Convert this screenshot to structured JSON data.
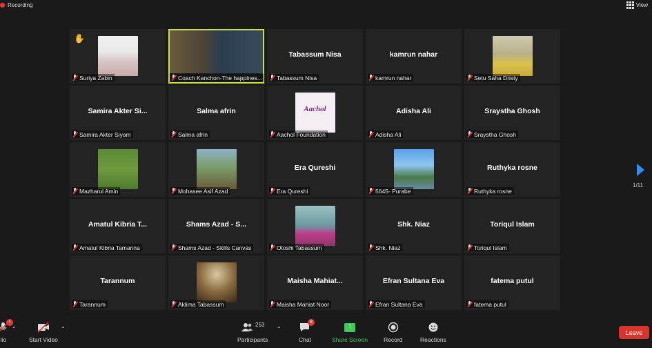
{
  "topbar": {
    "recording_label": "Recording",
    "view_label": "View"
  },
  "tiles": [
    {
      "display": "",
      "label": "Suriya Zabin",
      "photo": "ph-hijab",
      "hand": true
    },
    {
      "display": "",
      "label": "Coach Kanchon-The happines...",
      "photo": "ph-coach",
      "active": true
    },
    {
      "display": "Tabassum Nisa",
      "label": "Tabassum Nisa"
    },
    {
      "display": "kamrun nahar",
      "label": "kamrun nahar"
    },
    {
      "display": "",
      "label": "Setu Saha Dristy",
      "photo": "ph-setu"
    },
    {
      "display": "Samira Akter Si...",
      "label": "Samira Akter Siyam"
    },
    {
      "display": "Salma afrin",
      "label": "Salma afrin"
    },
    {
      "display": "",
      "label": "Aachol Foundation",
      "photo": "ph-aachol",
      "logo_text": "Aachol"
    },
    {
      "display": "Adisha Ali",
      "label": "Adisha Ali"
    },
    {
      "display": "Sraystha Ghosh",
      "label": "Sraystha Ghosh"
    },
    {
      "display": "",
      "label": "Mazharul Amin",
      "photo": "ph-mazhar"
    },
    {
      "display": "",
      "label": "Mohasee Asif Azad",
      "photo": "ph-mohasee"
    },
    {
      "display": "Era Qureshi",
      "label": "Era Qureshi"
    },
    {
      "display": "",
      "label": "5645- Purabe",
      "photo": "ph-5645"
    },
    {
      "display": "Ruthyka rosne",
      "label": "Ruthyka rosne"
    },
    {
      "display": "Amatul Kibria T...",
      "label": "Amatul Kibria Tamanna"
    },
    {
      "display": "Shams Azad - S...",
      "label": "Shams Azad - Skills Canvas"
    },
    {
      "display": "",
      "label": "Otoshi Tabassum",
      "photo": "ph-otoshi"
    },
    {
      "display": "Shk. Niaz",
      "label": "Shk. Niaz"
    },
    {
      "display": "Toriqul Islam",
      "label": "Toriqul Islam"
    },
    {
      "display": "Tarannum",
      "label": "Tarannum"
    },
    {
      "display": "",
      "label": "Aklima Tabassum",
      "photo": "ph-aklima"
    },
    {
      "display": "Maisha Mahiat...",
      "label": "Maisha Mahiat Noor"
    },
    {
      "display": "Efran Sultana Eva",
      "label": "Efran Sultana Eva"
    },
    {
      "display": "fatema putul",
      "label": "fatema putul"
    }
  ],
  "pager": {
    "page": "1/11"
  },
  "toolbar": {
    "audio_label": "lio",
    "video_label": "Start Video",
    "participants_label": "Participants",
    "participants_count": "253",
    "chat_label": "Chat",
    "chat_badge": "9",
    "share_label": "Share Screen",
    "record_label": "Record",
    "reactions_label": "Reactions",
    "leave_label": "Leave"
  },
  "colors": {
    "accent": "#2d8cff",
    "active_border": "#c8e04a",
    "leave": "#d9342b",
    "share": "#3ec95a"
  }
}
